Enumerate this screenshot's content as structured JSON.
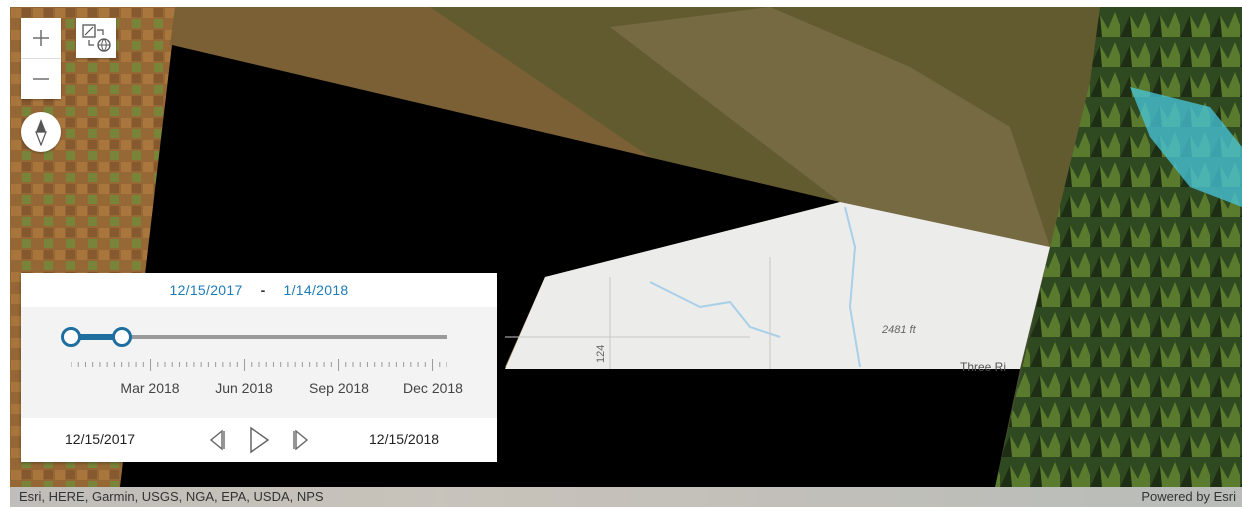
{
  "map": {
    "labels": {
      "elevation": "2481 ft",
      "place": "Three Ri",
      "road": "124"
    }
  },
  "controls": {
    "zoom_in_icon": "plus-icon",
    "zoom_out_icon": "minus-icon",
    "compass_icon": "compass-icon",
    "swipe_icon": "layer-swipe-icon"
  },
  "time_slider": {
    "range_start": "12/15/2017",
    "range_separator": "-",
    "range_end": "1/14/2018",
    "tick_labels": [
      "Mar 2018",
      "Jun 2018",
      "Sep 2018",
      "Dec 2018"
    ],
    "full_start": "12/15/2017",
    "full_end": "12/15/2018",
    "selection_start_fraction": 0.0,
    "selection_end_fraction": 0.082,
    "accent_color": "#1e6fa0",
    "date_color": "#1e7bb5",
    "buttons": {
      "previous_icon": "step-back-icon",
      "play_icon": "play-icon",
      "next_icon": "step-forward-icon"
    }
  },
  "attribution": {
    "sources": "Esri, HERE, Garmin, USGS, NGA, EPA, USDA, NPS",
    "powered_by": "Powered by Esri"
  }
}
